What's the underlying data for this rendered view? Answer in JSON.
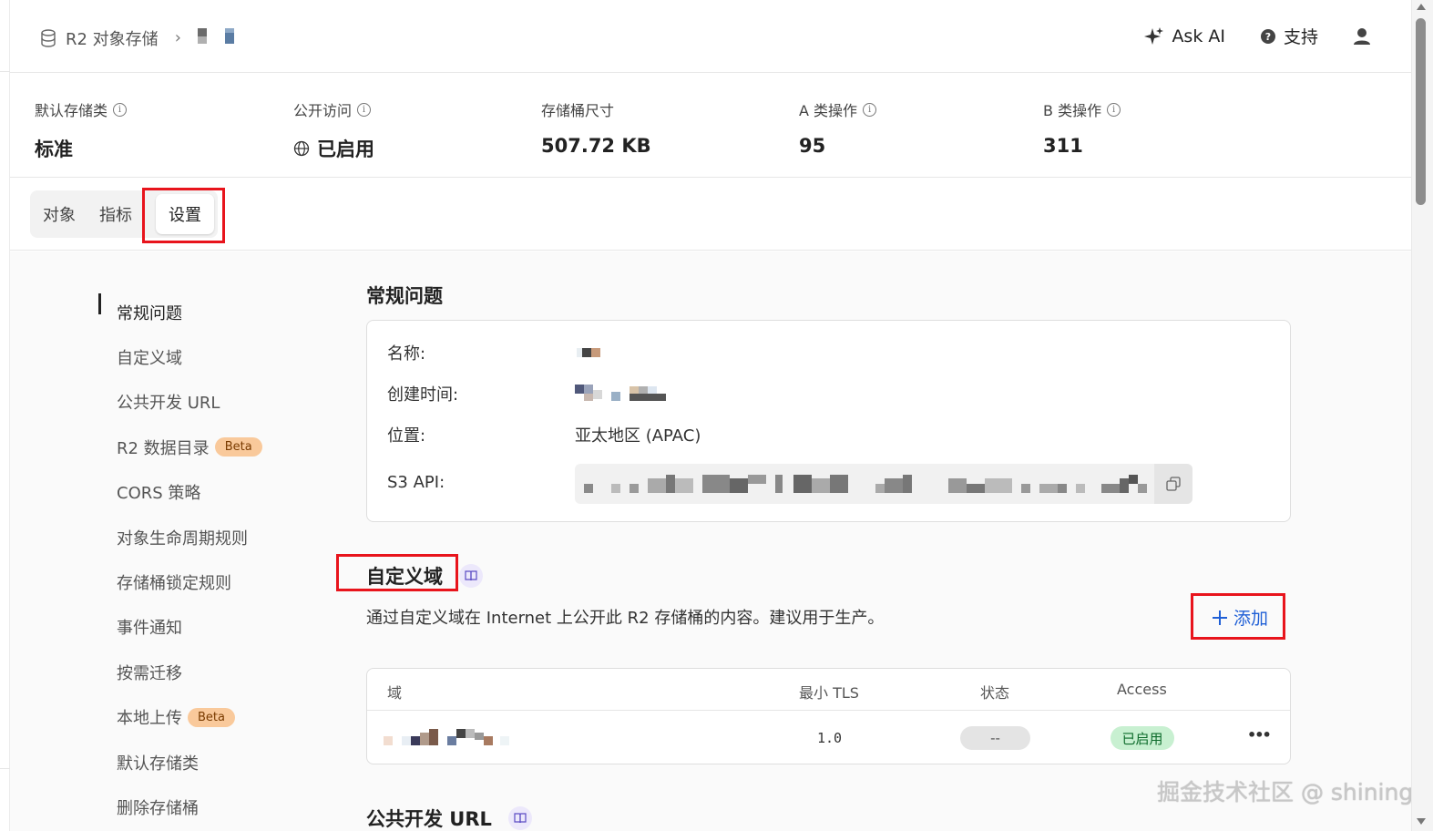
{
  "breadcrumb": {
    "root": "R2 对象存储"
  },
  "top_actions": {
    "ask_ai": "Ask AI",
    "support": "支持"
  },
  "stats": [
    {
      "label": "默认存储类",
      "value": "标准"
    },
    {
      "label": "公开访问",
      "value": "已启用"
    },
    {
      "label": "存储桶尺寸",
      "value": "507.72 KB"
    },
    {
      "label": "A 类操作",
      "value": "95"
    },
    {
      "label": "B 类操作",
      "value": "311"
    }
  ],
  "tabs": [
    "对象",
    "指标",
    "设置"
  ],
  "sidebar": {
    "items": [
      {
        "label": "常规问题"
      },
      {
        "label": "自定义域"
      },
      {
        "label": "公共开发 URL"
      },
      {
        "label": "R2 数据目录",
        "badge": "Beta"
      },
      {
        "label": "CORS 策略"
      },
      {
        "label": "对象生命周期规则"
      },
      {
        "label": "存储桶锁定规则"
      },
      {
        "label": "事件通知"
      },
      {
        "label": "按需迁移"
      },
      {
        "label": "本地上传",
        "badge": "Beta"
      },
      {
        "label": "默认存储类"
      },
      {
        "label": "删除存储桶"
      }
    ]
  },
  "general": {
    "title": "常规问题",
    "name_label": "名称:",
    "created_label": "创建时间:",
    "location_label": "位置:",
    "location_value": "亚太地区 (APAC)",
    "s3_label": "S3 API:"
  },
  "custom_domain": {
    "title": "自定义域",
    "description": "通过自定义域在 Internet 上公开此 R2 存储桶的内容。建议用于生产。",
    "add_label": "添加",
    "columns": [
      "域",
      "最小 TLS",
      "状态",
      "Access"
    ],
    "rows": [
      {
        "min_tls": "1.0",
        "status": "--",
        "access": "已启用",
        "more": "•••"
      }
    ]
  },
  "public_dev_url": {
    "title": "公共开发 URL"
  },
  "watermark": "掘金技术社区 @ shining",
  "colors": {
    "accent": "#1f5fd6",
    "highlight": "#e8141c",
    "beta_bg": "#f9c99b",
    "enabled_bg": "#c8f0d1"
  }
}
